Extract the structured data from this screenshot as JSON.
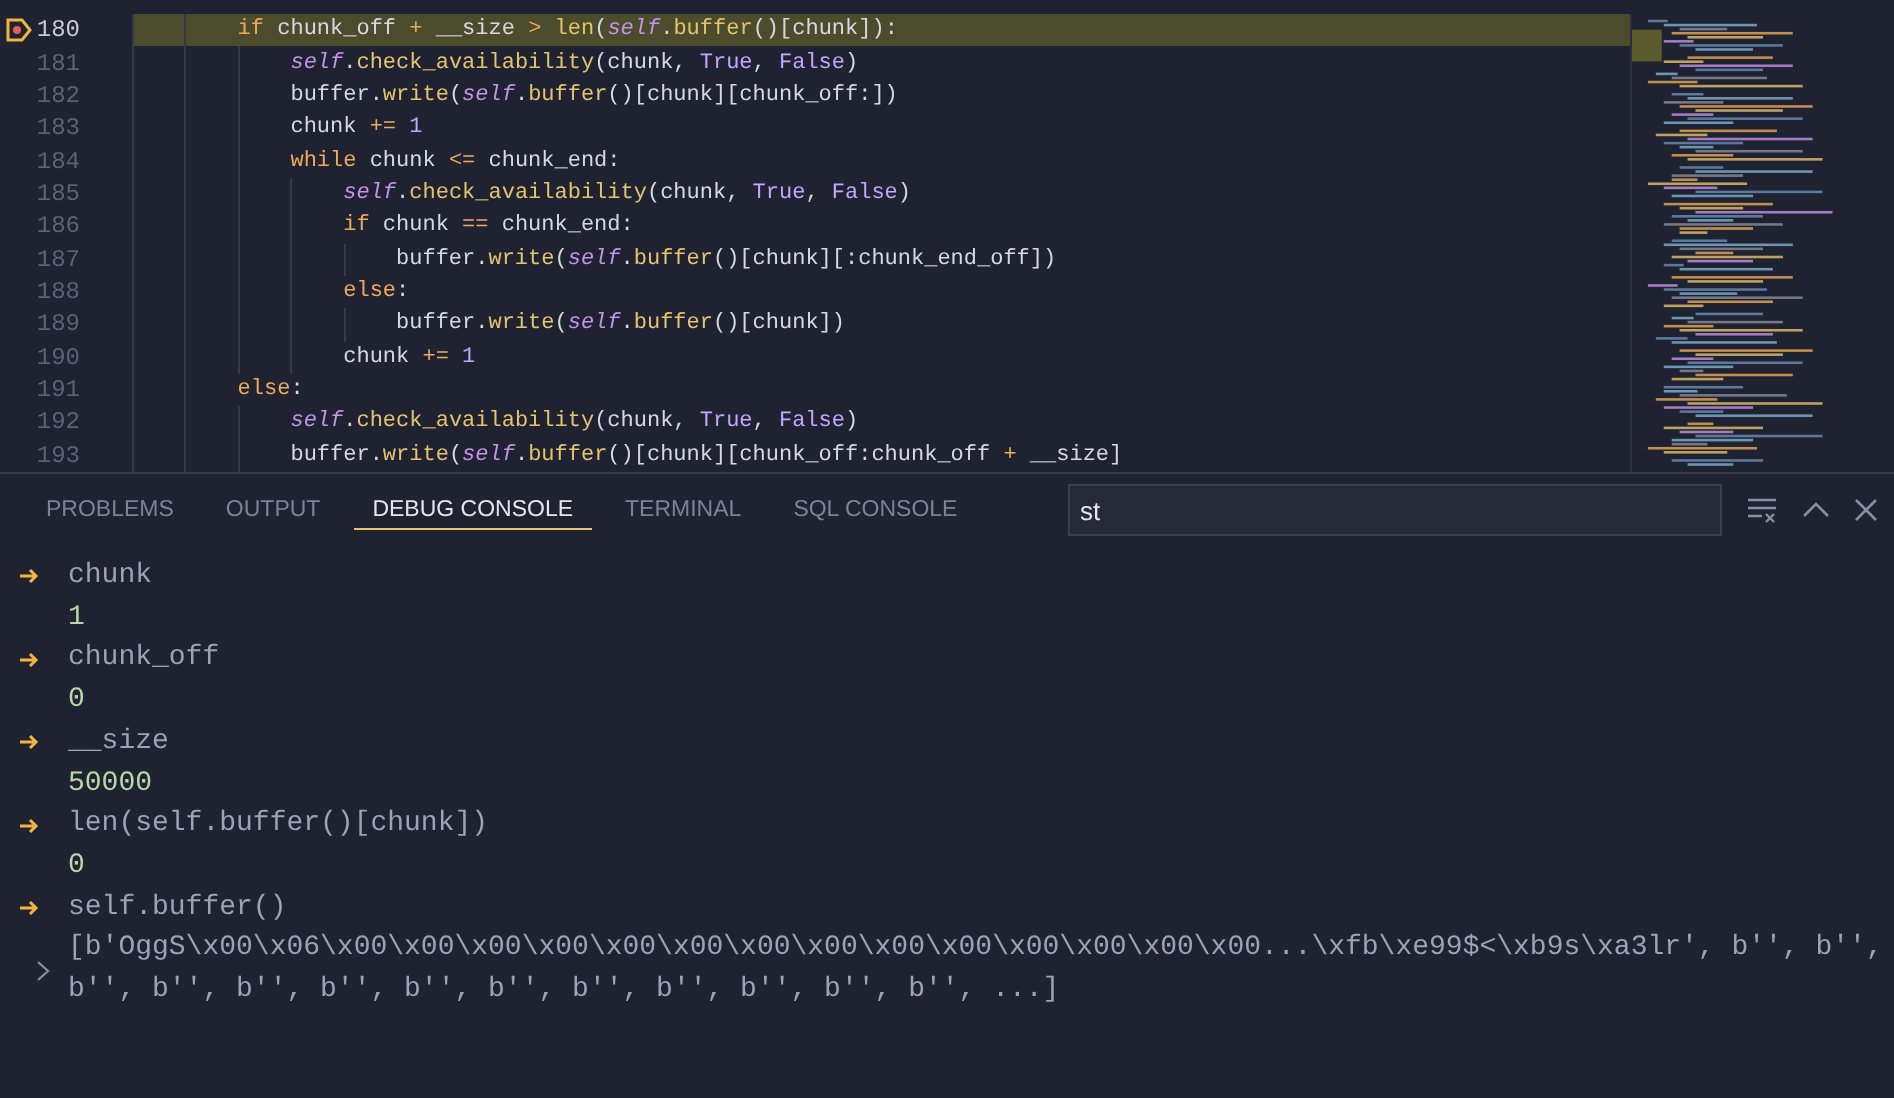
{
  "editor": {
    "lines": [
      {
        "number": "180",
        "current": true,
        "tokens": [
          {
            "kind": "keyword",
            "text": "        if"
          },
          {
            "kind": "plain",
            "text": " chunk_off "
          },
          {
            "kind": "operator",
            "text": "+"
          },
          {
            "kind": "plain",
            "text": " __size "
          },
          {
            "kind": "operator",
            "text": ">"
          },
          {
            "kind": "function",
            "text": " len"
          },
          {
            "kind": "plain",
            "text": "("
          },
          {
            "kind": "self",
            "text": "self"
          },
          {
            "kind": "plain",
            "text": "."
          },
          {
            "kind": "function",
            "text": "buffer"
          },
          {
            "kind": "plain",
            "text": "()[chunk]):"
          }
        ]
      },
      {
        "number": "181",
        "current": false,
        "tokens": [
          {
            "kind": "self",
            "text": "            self"
          },
          {
            "kind": "plain",
            "text": "."
          },
          {
            "kind": "function",
            "text": "check_availability"
          },
          {
            "kind": "plain",
            "text": "(chunk, "
          },
          {
            "kind": "constant",
            "text": "True"
          },
          {
            "kind": "plain",
            "text": ", "
          },
          {
            "kind": "constant",
            "text": "False"
          },
          {
            "kind": "plain",
            "text": ")"
          }
        ]
      },
      {
        "number": "182",
        "current": false,
        "tokens": [
          {
            "kind": "plain",
            "text": "            buffer."
          },
          {
            "kind": "function",
            "text": "write"
          },
          {
            "kind": "plain",
            "text": "("
          },
          {
            "kind": "self",
            "text": "self"
          },
          {
            "kind": "plain",
            "text": "."
          },
          {
            "kind": "function",
            "text": "buffer"
          },
          {
            "kind": "plain",
            "text": "()[chunk][chunk_off:])"
          }
        ]
      },
      {
        "number": "183",
        "current": false,
        "tokens": [
          {
            "kind": "plain",
            "text": "            chunk "
          },
          {
            "kind": "operator",
            "text": "+="
          },
          {
            "kind": "constant",
            "text": " 1"
          }
        ]
      },
      {
        "number": "184",
        "current": false,
        "tokens": [
          {
            "kind": "keyword",
            "text": "            while"
          },
          {
            "kind": "plain",
            "text": " chunk "
          },
          {
            "kind": "operator",
            "text": "<="
          },
          {
            "kind": "plain",
            "text": " chunk_end:"
          }
        ]
      },
      {
        "number": "185",
        "current": false,
        "tokens": [
          {
            "kind": "self",
            "text": "                self"
          },
          {
            "kind": "plain",
            "text": "."
          },
          {
            "kind": "function",
            "text": "check_availability"
          },
          {
            "kind": "plain",
            "text": "(chunk, "
          },
          {
            "kind": "constant",
            "text": "True"
          },
          {
            "kind": "plain",
            "text": ", "
          },
          {
            "kind": "constant",
            "text": "False"
          },
          {
            "kind": "plain",
            "text": ")"
          }
        ]
      },
      {
        "number": "186",
        "current": false,
        "tokens": [
          {
            "kind": "keyword",
            "text": "                if"
          },
          {
            "kind": "plain",
            "text": " chunk "
          },
          {
            "kind": "operator",
            "text": "=="
          },
          {
            "kind": "plain",
            "text": " chunk_end:"
          }
        ]
      },
      {
        "number": "187",
        "current": false,
        "tokens": [
          {
            "kind": "plain",
            "text": "                    buffer."
          },
          {
            "kind": "function",
            "text": "write"
          },
          {
            "kind": "plain",
            "text": "("
          },
          {
            "kind": "self",
            "text": "self"
          },
          {
            "kind": "plain",
            "text": "."
          },
          {
            "kind": "function",
            "text": "buffer"
          },
          {
            "kind": "plain",
            "text": "()[chunk][:chunk_end_off])"
          }
        ]
      },
      {
        "number": "188",
        "current": false,
        "tokens": [
          {
            "kind": "keyword",
            "text": "                else"
          },
          {
            "kind": "plain",
            "text": ":"
          }
        ]
      },
      {
        "number": "189",
        "current": false,
        "tokens": [
          {
            "kind": "plain",
            "text": "                    buffer."
          },
          {
            "kind": "function",
            "text": "write"
          },
          {
            "kind": "plain",
            "text": "("
          },
          {
            "kind": "self",
            "text": "self"
          },
          {
            "kind": "plain",
            "text": "."
          },
          {
            "kind": "function",
            "text": "buffer"
          },
          {
            "kind": "plain",
            "text": "()[chunk])"
          }
        ]
      },
      {
        "number": "190",
        "current": false,
        "tokens": [
          {
            "kind": "plain",
            "text": "                chunk "
          },
          {
            "kind": "operator",
            "text": "+="
          },
          {
            "kind": "constant",
            "text": " 1"
          }
        ]
      },
      {
        "number": "191",
        "current": false,
        "tokens": [
          {
            "kind": "keyword",
            "text": "        else"
          },
          {
            "kind": "plain",
            "text": ":"
          }
        ]
      },
      {
        "number": "192",
        "current": false,
        "tokens": [
          {
            "kind": "self",
            "text": "            self"
          },
          {
            "kind": "plain",
            "text": "."
          },
          {
            "kind": "function",
            "text": "check_availability"
          },
          {
            "kind": "plain",
            "text": "(chunk, "
          },
          {
            "kind": "constant",
            "text": "True"
          },
          {
            "kind": "plain",
            "text": ", "
          },
          {
            "kind": "constant",
            "text": "False"
          },
          {
            "kind": "plain",
            "text": ")"
          }
        ]
      },
      {
        "number": "193",
        "current": false,
        "tokens": [
          {
            "kind": "plain",
            "text": "            buffer."
          },
          {
            "kind": "function",
            "text": "write"
          },
          {
            "kind": "plain",
            "text": "("
          },
          {
            "kind": "self",
            "text": "self"
          },
          {
            "kind": "plain",
            "text": "."
          },
          {
            "kind": "function",
            "text": "buffer"
          },
          {
            "kind": "plain",
            "text": "()[chunk][chunk_off:chunk_off "
          },
          {
            "kind": "operator",
            "text": "+"
          },
          {
            "kind": "plain",
            "text": " __size]"
          }
        ]
      }
    ]
  },
  "panel": {
    "tabs": [
      {
        "label": "PROBLEMS",
        "selected": false
      },
      {
        "label": "OUTPUT",
        "selected": false
      },
      {
        "label": "DEBUG CONSOLE",
        "selected": true
      },
      {
        "label": "TERMINAL",
        "selected": false
      },
      {
        "label": "SQL CONSOLE",
        "selected": false
      }
    ],
    "filter": {
      "value": "st"
    },
    "console": [
      {
        "kind": "input",
        "text": "chunk"
      },
      {
        "kind": "output",
        "text": "1"
      },
      {
        "kind": "input",
        "text": "chunk_off"
      },
      {
        "kind": "output",
        "text": "0"
      },
      {
        "kind": "input",
        "text": "__size"
      },
      {
        "kind": "output",
        "text": "50000"
      },
      {
        "kind": "input",
        "text": "len(self.buffer()[chunk])"
      },
      {
        "kind": "output",
        "text": "0"
      },
      {
        "kind": "input",
        "text": "self.buffer()"
      },
      {
        "kind": "expandable",
        "expanded": false,
        "lines": [
          "[b'OggS\\x00\\x06\\x00\\x00\\x00\\x00\\x00\\x00\\x00\\x00\\x00\\x00\\x00\\x00\\x00\\x00...\\xfb\\xe99$<\\xb9s\\xa3lr', b'', b'',",
          "b'', b'', b'', b'', b'', b'', b'', b'', b'', b'', b'', ...]"
        ]
      }
    ]
  }
}
